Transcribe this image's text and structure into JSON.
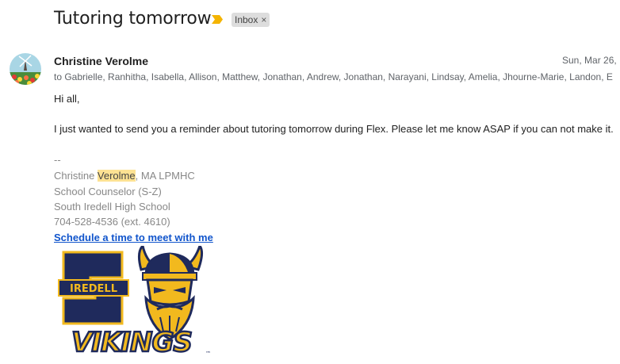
{
  "subject": "Tutoring tomorrow",
  "label": {
    "text": "Inbox",
    "remove": "×"
  },
  "sender": "Christine Verolme",
  "date": "Sun, Mar 26,",
  "recipients": "to Gabrielle, Ranhitha, Isabella, Allison, Matthew, Jonathan, Andrew, Jonathan, Narayani, Lindsay, Amelia, Jhourne-Marie, Landon, E",
  "body": {
    "greeting": "Hi all,",
    "message": "I just wanted to send you a reminder about tutoring tomorrow during Flex. Please let me know ASAP if you can not make it."
  },
  "signature": {
    "separator": "--",
    "first_name": "Christine ",
    "last_name": "Verolme",
    "credentials": ", MA LPMHC",
    "title": "School Counselor (S-Z)",
    "school": "South Iredell High School",
    "phone": "704-528-4536 (ext. 4610)",
    "link_text": "Schedule a time to meet with me"
  },
  "logo": {
    "top_text": "IREDELL",
    "bottom_text": "VIKINGS",
    "tm": "™"
  },
  "colors": {
    "navy": "#1f2a5c",
    "gold": "#f2b91e",
    "link": "#1155cc",
    "highlight": "#fde293"
  }
}
